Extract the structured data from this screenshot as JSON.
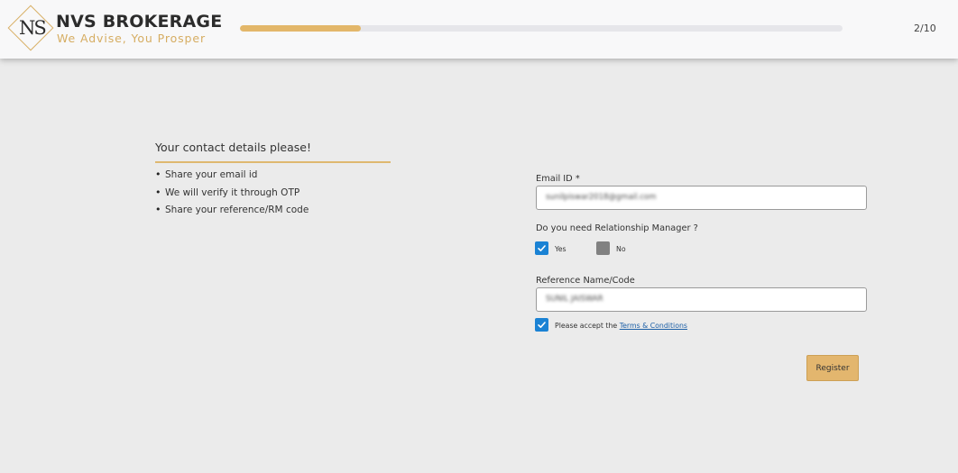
{
  "header": {
    "logo_mark": "NS",
    "brand_name": "NVS BROKERAGE",
    "tagline": "We Advise, You Prosper",
    "progress": {
      "fraction": 0.2,
      "label": "2/10"
    }
  },
  "intro": {
    "heading": "Your contact details please!",
    "bullets": [
      "Share your email id",
      "We will verify it through OTP",
      "Share your reference/RM code"
    ]
  },
  "form": {
    "email": {
      "label": "Email ID *",
      "value": "sunilpiswar2018@gmail.com"
    },
    "rm_question": "Do you need Relationship Manager ?",
    "rm_options": [
      {
        "label": "Yes",
        "checked": true
      },
      {
        "label": "No",
        "checked": false
      }
    ],
    "reference": {
      "label": "Reference Name/Code",
      "value": "SUNIL JAISWAR"
    },
    "terms": {
      "checked": true,
      "prefix": "Please accept the",
      "link": "Terms & Conditions"
    },
    "register_label": "Register"
  },
  "colors": {
    "accent_gold": "#e3b66e",
    "checkbox_blue": "#1a82d4",
    "checkbox_gray": "#818181",
    "link_blue": "#1c5fa6"
  }
}
